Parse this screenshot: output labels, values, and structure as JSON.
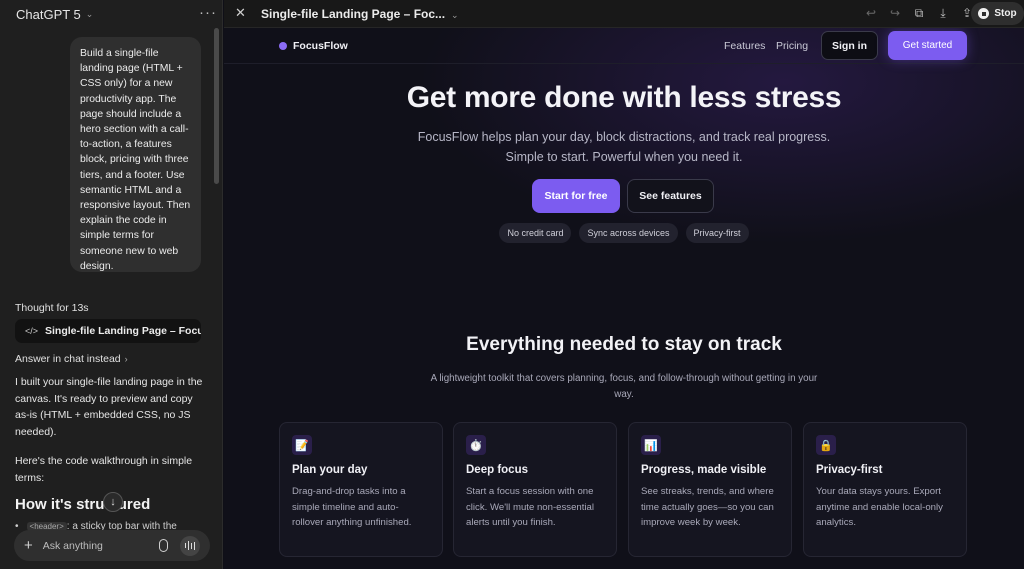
{
  "chat": {
    "model_name": "ChatGPT 5",
    "user_message": "Build a single-file landing page (HTML + CSS only) for a new productivity app. The page should include a hero section with a call-to-action, a features block, pricing with three tiers, and a footer. Use semantic HTML and a responsive layout. Then explain the code in simple terms for someone new to web design.",
    "thought_label": "Thought for 13s",
    "canvas_chip_label": "Single-file Landing Page – Focus",
    "answer_in_chat": "Answer in chat instead",
    "assistant_p1": "I built your single-file landing page in the canvas. It's ready to preview and copy as-is (HTML + embedded CSS, no JS needed).",
    "assistant_p2": "Here's the code walkthrough in simple terms:",
    "section_heading": "How it's structured",
    "peek_tag": "<header>",
    "peek_text": ": a sticky top bar with the",
    "composer_placeholder": "Ask anything"
  },
  "canvas": {
    "title": "Single-file Landing Page – Foc...",
    "stop_label": "Stop"
  },
  "site": {
    "brand": "FocusFlow",
    "brand_color": "#8b6cf6",
    "nav_features": "Features",
    "nav_pricing": "Pricing",
    "sign_in": "Sign in",
    "get_started": "Get started",
    "hero_title": "Get more done with less stress",
    "hero_sub_1": "FocusFlow helps plan your day, block distractions, and track real progress.",
    "hero_sub_2": "Simple to start. Powerful when you need it.",
    "cta_primary": "Start for free",
    "cta_secondary": "See features",
    "pills": [
      "No credit card",
      "Sync across devices",
      "Privacy-first"
    ],
    "features_title": "Everything needed to stay on track",
    "features_sub": "A lightweight toolkit that covers planning, focus, and follow-through without getting in your way.",
    "cards": [
      {
        "icon": "📝",
        "icon_name": "memo-icon",
        "title": "Plan your day",
        "text": "Drag-and-drop tasks into a simple timeline and auto-rollover anything unfinished."
      },
      {
        "icon": "⏱️",
        "icon_name": "stopwatch-icon",
        "title": "Deep focus",
        "text": "Start a focus session with one click. We'll mute non-essential alerts until you finish."
      },
      {
        "icon": "📊",
        "icon_name": "bar-chart-icon",
        "title": "Progress, made visible",
        "text": "See streaks, trends, and where time actually goes—so you can improve week by week."
      },
      {
        "icon": "🔒",
        "icon_name": "lock-icon",
        "title": "Privacy-first",
        "text": "Your data stays yours. Export anytime and enable local-only analytics."
      }
    ],
    "accent_color": "#7c5cf0"
  }
}
